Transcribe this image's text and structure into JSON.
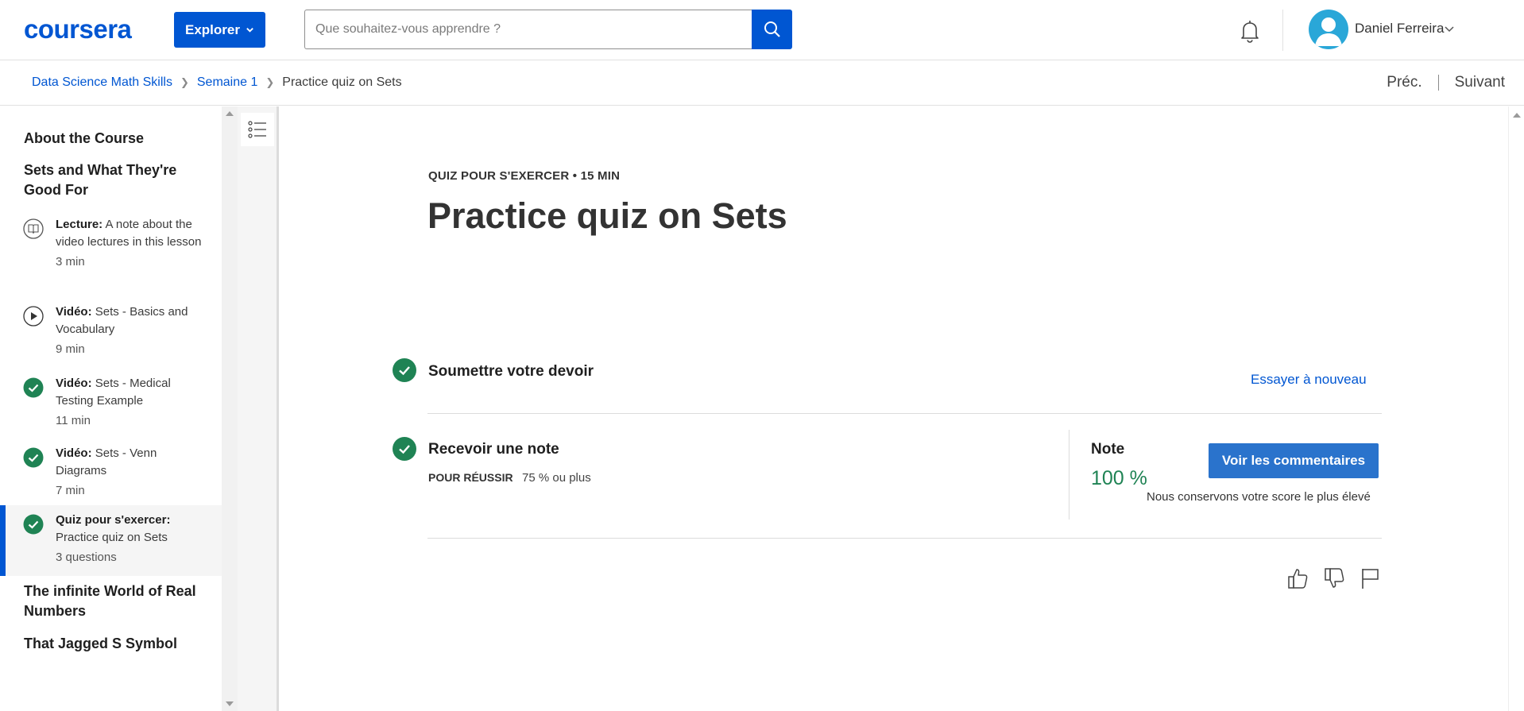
{
  "header": {
    "logo": "coursera",
    "explore_label": "Explorer",
    "search_placeholder": "Que souhaitez-vous apprendre ?",
    "username": "Daniel Ferreira",
    "brand_color": "#0056d2"
  },
  "breadcrumb": {
    "items": [
      "Data Science Math Skills",
      "Semaine 1"
    ],
    "current": "Practice quiz on Sets",
    "prev_label": "Préc.",
    "next_label": "Suivant"
  },
  "sidebar": {
    "sections": [
      "About the Course",
      "Sets and What They're Good For",
      "The infinite World of Real Numbers",
      "That Jagged S Symbol"
    ],
    "items": [
      {
        "type": "Lecture:",
        "title": "A note about the video lectures in this lesson",
        "duration": "3 min",
        "icon": "reading-icon",
        "status": "incomplete"
      },
      {
        "type": "Vidéo:",
        "title": "Sets - Basics and Vocabulary",
        "duration": "9 min",
        "icon": "play-icon",
        "status": "incomplete"
      },
      {
        "type": "Vidéo:",
        "title": "Sets - Medical Testing Example",
        "duration": "11 min",
        "icon": "check-circle-icon",
        "status": "completed"
      },
      {
        "type": "Vidéo:",
        "title": "Sets - Venn Diagrams",
        "duration": "7 min",
        "icon": "check-circle-icon",
        "status": "completed"
      },
      {
        "type": "Quiz pour s'exercer:",
        "title": "Practice quiz on Sets",
        "duration": "3 questions",
        "icon": "check-circle-icon",
        "status": "completed",
        "active": true
      }
    ]
  },
  "main": {
    "kicker": "QUIZ POUR S'EXERCER • 15 MIN",
    "title": "Practice quiz on Sets",
    "step1_title": "Soumettre votre devoir",
    "retry_label": "Essayer à nouveau",
    "step2_title": "Recevoir une note",
    "pass_label": "POUR RÉUSSIR",
    "pass_value": "75 % ou plus",
    "note_label": "Note",
    "note_value": "100 %",
    "comments_label": "Voir les commentaires",
    "keep_note": "Nous conservons votre score le plus élevé",
    "success_color": "#1f8354"
  }
}
